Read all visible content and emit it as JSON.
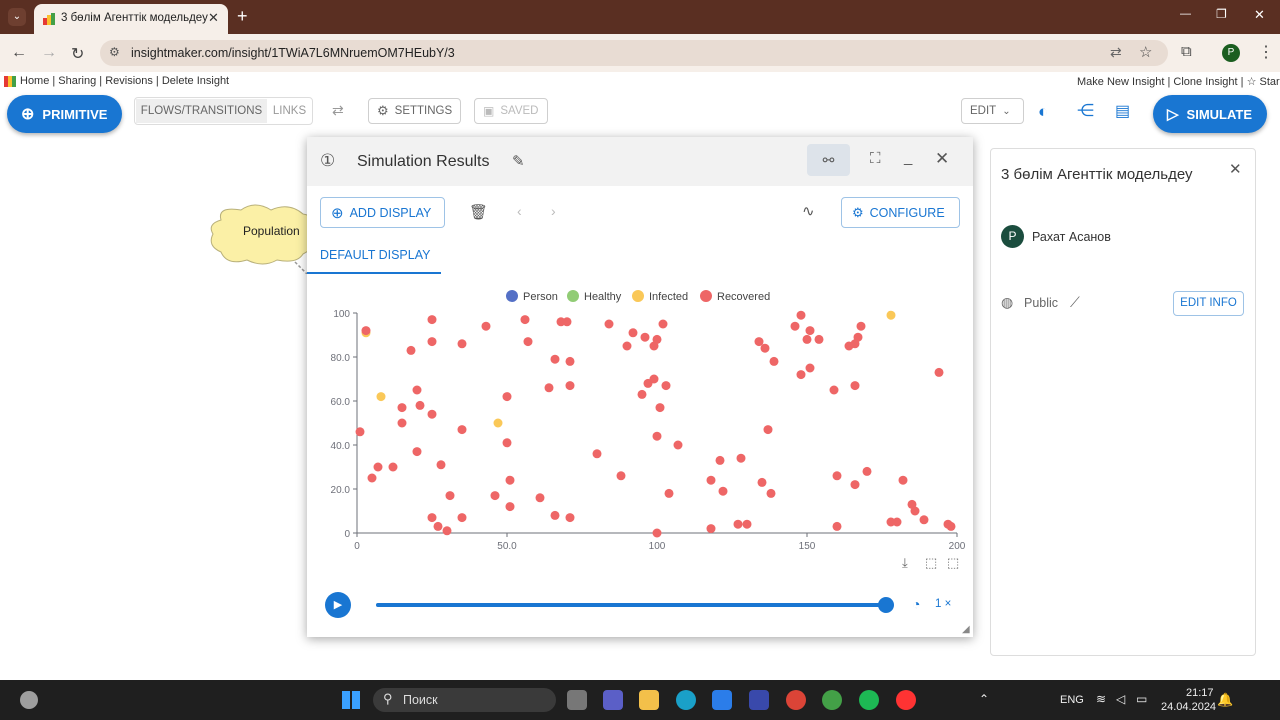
{
  "browser": {
    "tab_title": "3 бөлім Агенттік модельдеу",
    "tab_close": "✕",
    "new_tab": "+",
    "url": "insightmaker.com/insight/1TWiA7L6MNruemOM7HEubY/3",
    "profile_initial": "P",
    "window_controls": {
      "minimize": "—",
      "maximize": "❐",
      "close": "✕"
    }
  },
  "bookmarks": {
    "left": "Home | Sharing | Revisions | Delete Insight",
    "right": "Make New Insight | Clone Insight | ☆ Star |"
  },
  "toolbar": {
    "primitive": "PRIMITIVE",
    "flows": "FLOWS/TRANSITIONS",
    "links": "LINKS",
    "settings": "SETTINGS",
    "saved": "SAVED",
    "edit": "EDIT",
    "simulate": "SIMULATE"
  },
  "canvas": {
    "node_label": "Population"
  },
  "results": {
    "number": "①",
    "title": "Simulation Results",
    "add_display": "ADD DISPLAY",
    "configure": "CONFIGURE",
    "tab": "DEFAULT DISPLAY",
    "speed": "1 ×",
    "playback_progress": 1.0
  },
  "info": {
    "title": "3 бөлім Агенттік модельдеу",
    "author_initial": "P",
    "author": "Рахат Асанов",
    "visibility": "Public",
    "edit_info": "EDIT INFO"
  },
  "taskbar": {
    "search": "Поиск",
    "lang": "ENG",
    "time": "21:17",
    "date": "24.04.2024"
  },
  "colors": {
    "person": "#5470c6",
    "healthy": "#91cc75",
    "infected": "#fac858",
    "recovered": "#ee6666",
    "accent": "#1976d2"
  },
  "chart_data": {
    "type": "scatter",
    "legend": [
      "Person",
      "Healthy",
      "Infected",
      "Recovered"
    ],
    "legend_position": "top-center",
    "xlim": [
      0,
      200
    ],
    "ylim": [
      0,
      100
    ],
    "x_ticks": [
      "0",
      "50.0",
      "100",
      "150",
      "200"
    ],
    "y_ticks": [
      "0",
      "20.0",
      "40.0",
      "60.0",
      "80.0",
      "100"
    ],
    "series": [
      {
        "name": "Infected",
        "color": "#fac858",
        "points": [
          [
            3,
            91
          ],
          [
            8,
            62
          ],
          [
            47,
            50
          ],
          [
            178,
            99
          ]
        ]
      },
      {
        "name": "Recovered",
        "color": "#ee6666",
        "points": [
          [
            1,
            46
          ],
          [
            3,
            92
          ],
          [
            5,
            25
          ],
          [
            7,
            30
          ],
          [
            12,
            30
          ],
          [
            15,
            50
          ],
          [
            15,
            57
          ],
          [
            18,
            83
          ],
          [
            20,
            37
          ],
          [
            20,
            65
          ],
          [
            21,
            58
          ],
          [
            25,
            87
          ],
          [
            25,
            54
          ],
          [
            25,
            7
          ],
          [
            25,
            97
          ],
          [
            27,
            3
          ],
          [
            28,
            31
          ],
          [
            30,
            1
          ],
          [
            31,
            17
          ],
          [
            35,
            86
          ],
          [
            35,
            47
          ],
          [
            35,
            7
          ],
          [
            43,
            94
          ],
          [
            46,
            17
          ],
          [
            50,
            62
          ],
          [
            50,
            41
          ],
          [
            51,
            24
          ],
          [
            51,
            12
          ],
          [
            56,
            97
          ],
          [
            57,
            87
          ],
          [
            61,
            16
          ],
          [
            64,
            66
          ],
          [
            66,
            79
          ],
          [
            66,
            8
          ],
          [
            68,
            96
          ],
          [
            70,
            96
          ],
          [
            71,
            78
          ],
          [
            71,
            67
          ],
          [
            71,
            7
          ],
          [
            80,
            36
          ],
          [
            84,
            95
          ],
          [
            88,
            26
          ],
          [
            90,
            85
          ],
          [
            92,
            91
          ],
          [
            95,
            63
          ],
          [
            96,
            89
          ],
          [
            97,
            68
          ],
          [
            99,
            85
          ],
          [
            99,
            70
          ],
          [
            100,
            44
          ],
          [
            100,
            0
          ],
          [
            100,
            88
          ],
          [
            101,
            57
          ],
          [
            102,
            95
          ],
          [
            103,
            67
          ],
          [
            104,
            18
          ],
          [
            107,
            40
          ],
          [
            118,
            24
          ],
          [
            118,
            2
          ],
          [
            121,
            33
          ],
          [
            122,
            19
          ],
          [
            127,
            4
          ],
          [
            128,
            34
          ],
          [
            130,
            4
          ],
          [
            134,
            87
          ],
          [
            135,
            23
          ],
          [
            136,
            84
          ],
          [
            137,
            47
          ],
          [
            138,
            18
          ],
          [
            139,
            78
          ],
          [
            146,
            94
          ],
          [
            148,
            99
          ],
          [
            148,
            72
          ],
          [
            150,
            88
          ],
          [
            151,
            92
          ],
          [
            151,
            75
          ],
          [
            154,
            88
          ],
          [
            159,
            65
          ],
          [
            160,
            3
          ],
          [
            160,
            26
          ],
          [
            164,
            85
          ],
          [
            166,
            86
          ],
          [
            166,
            67
          ],
          [
            166,
            22
          ],
          [
            167,
            89
          ],
          [
            168,
            94
          ],
          [
            170,
            28
          ],
          [
            178,
            5
          ],
          [
            180,
            5
          ],
          [
            182,
            24
          ],
          [
            185,
            13
          ],
          [
            186,
            10
          ],
          [
            189,
            6
          ],
          [
            194,
            73
          ],
          [
            197,
            4
          ],
          [
            198,
            3
          ]
        ]
      }
    ]
  }
}
